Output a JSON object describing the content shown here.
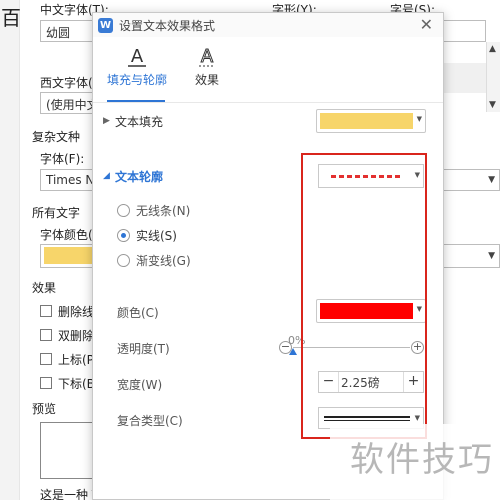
{
  "background": {
    "big_char": "百",
    "chinese_font_label": "中文字体(T):",
    "chinese_font_value": "幼圆",
    "font_style_label": "字形(Y):",
    "font_size_label": "字号(S):",
    "western_font_label": "西文字体(X):",
    "western_font_value": "(使用中文",
    "complex_font_label": "复杂文种",
    "font_label": "字体(F):",
    "font_value": "Times N",
    "all_text_label": "所有文字",
    "font_color_label": "字体颜色(",
    "font_color": "#f7d56a",
    "effects_label": "效果",
    "effects": [
      "删除线",
      "双删除",
      "上标(P",
      "下标(B"
    ],
    "preview_label": "预览",
    "footer_text": "这是一种 TrueType 字体，同时适用于屏幕和打印机。"
  },
  "dialog": {
    "title": "设置文本效果格式",
    "close_glyph": "✕",
    "tabs": [
      {
        "label": "填充与轮廓",
        "active": true
      },
      {
        "label": "效果",
        "active": false
      }
    ],
    "text_fill": {
      "label": "文本填充",
      "color": "#f7d56a"
    },
    "text_outline": {
      "label": "文本轮廓",
      "line_color": "#e3302f"
    },
    "outline_options": [
      {
        "label": "无线条(N)",
        "checked": false
      },
      {
        "label": "实线(S)",
        "checked": true
      },
      {
        "label": "渐变线(G)",
        "checked": false
      }
    ],
    "color": {
      "label": "颜色(C)",
      "value": "#ff0000"
    },
    "transparency": {
      "label": "透明度(T)",
      "value": "0%",
      "percent": 0
    },
    "width": {
      "label": "宽度(W)",
      "value": "2.25磅",
      "minus": "−",
      "plus": "+"
    },
    "compound_type": {
      "label": "复合类型(C)"
    }
  },
  "watermark": "软件技巧"
}
